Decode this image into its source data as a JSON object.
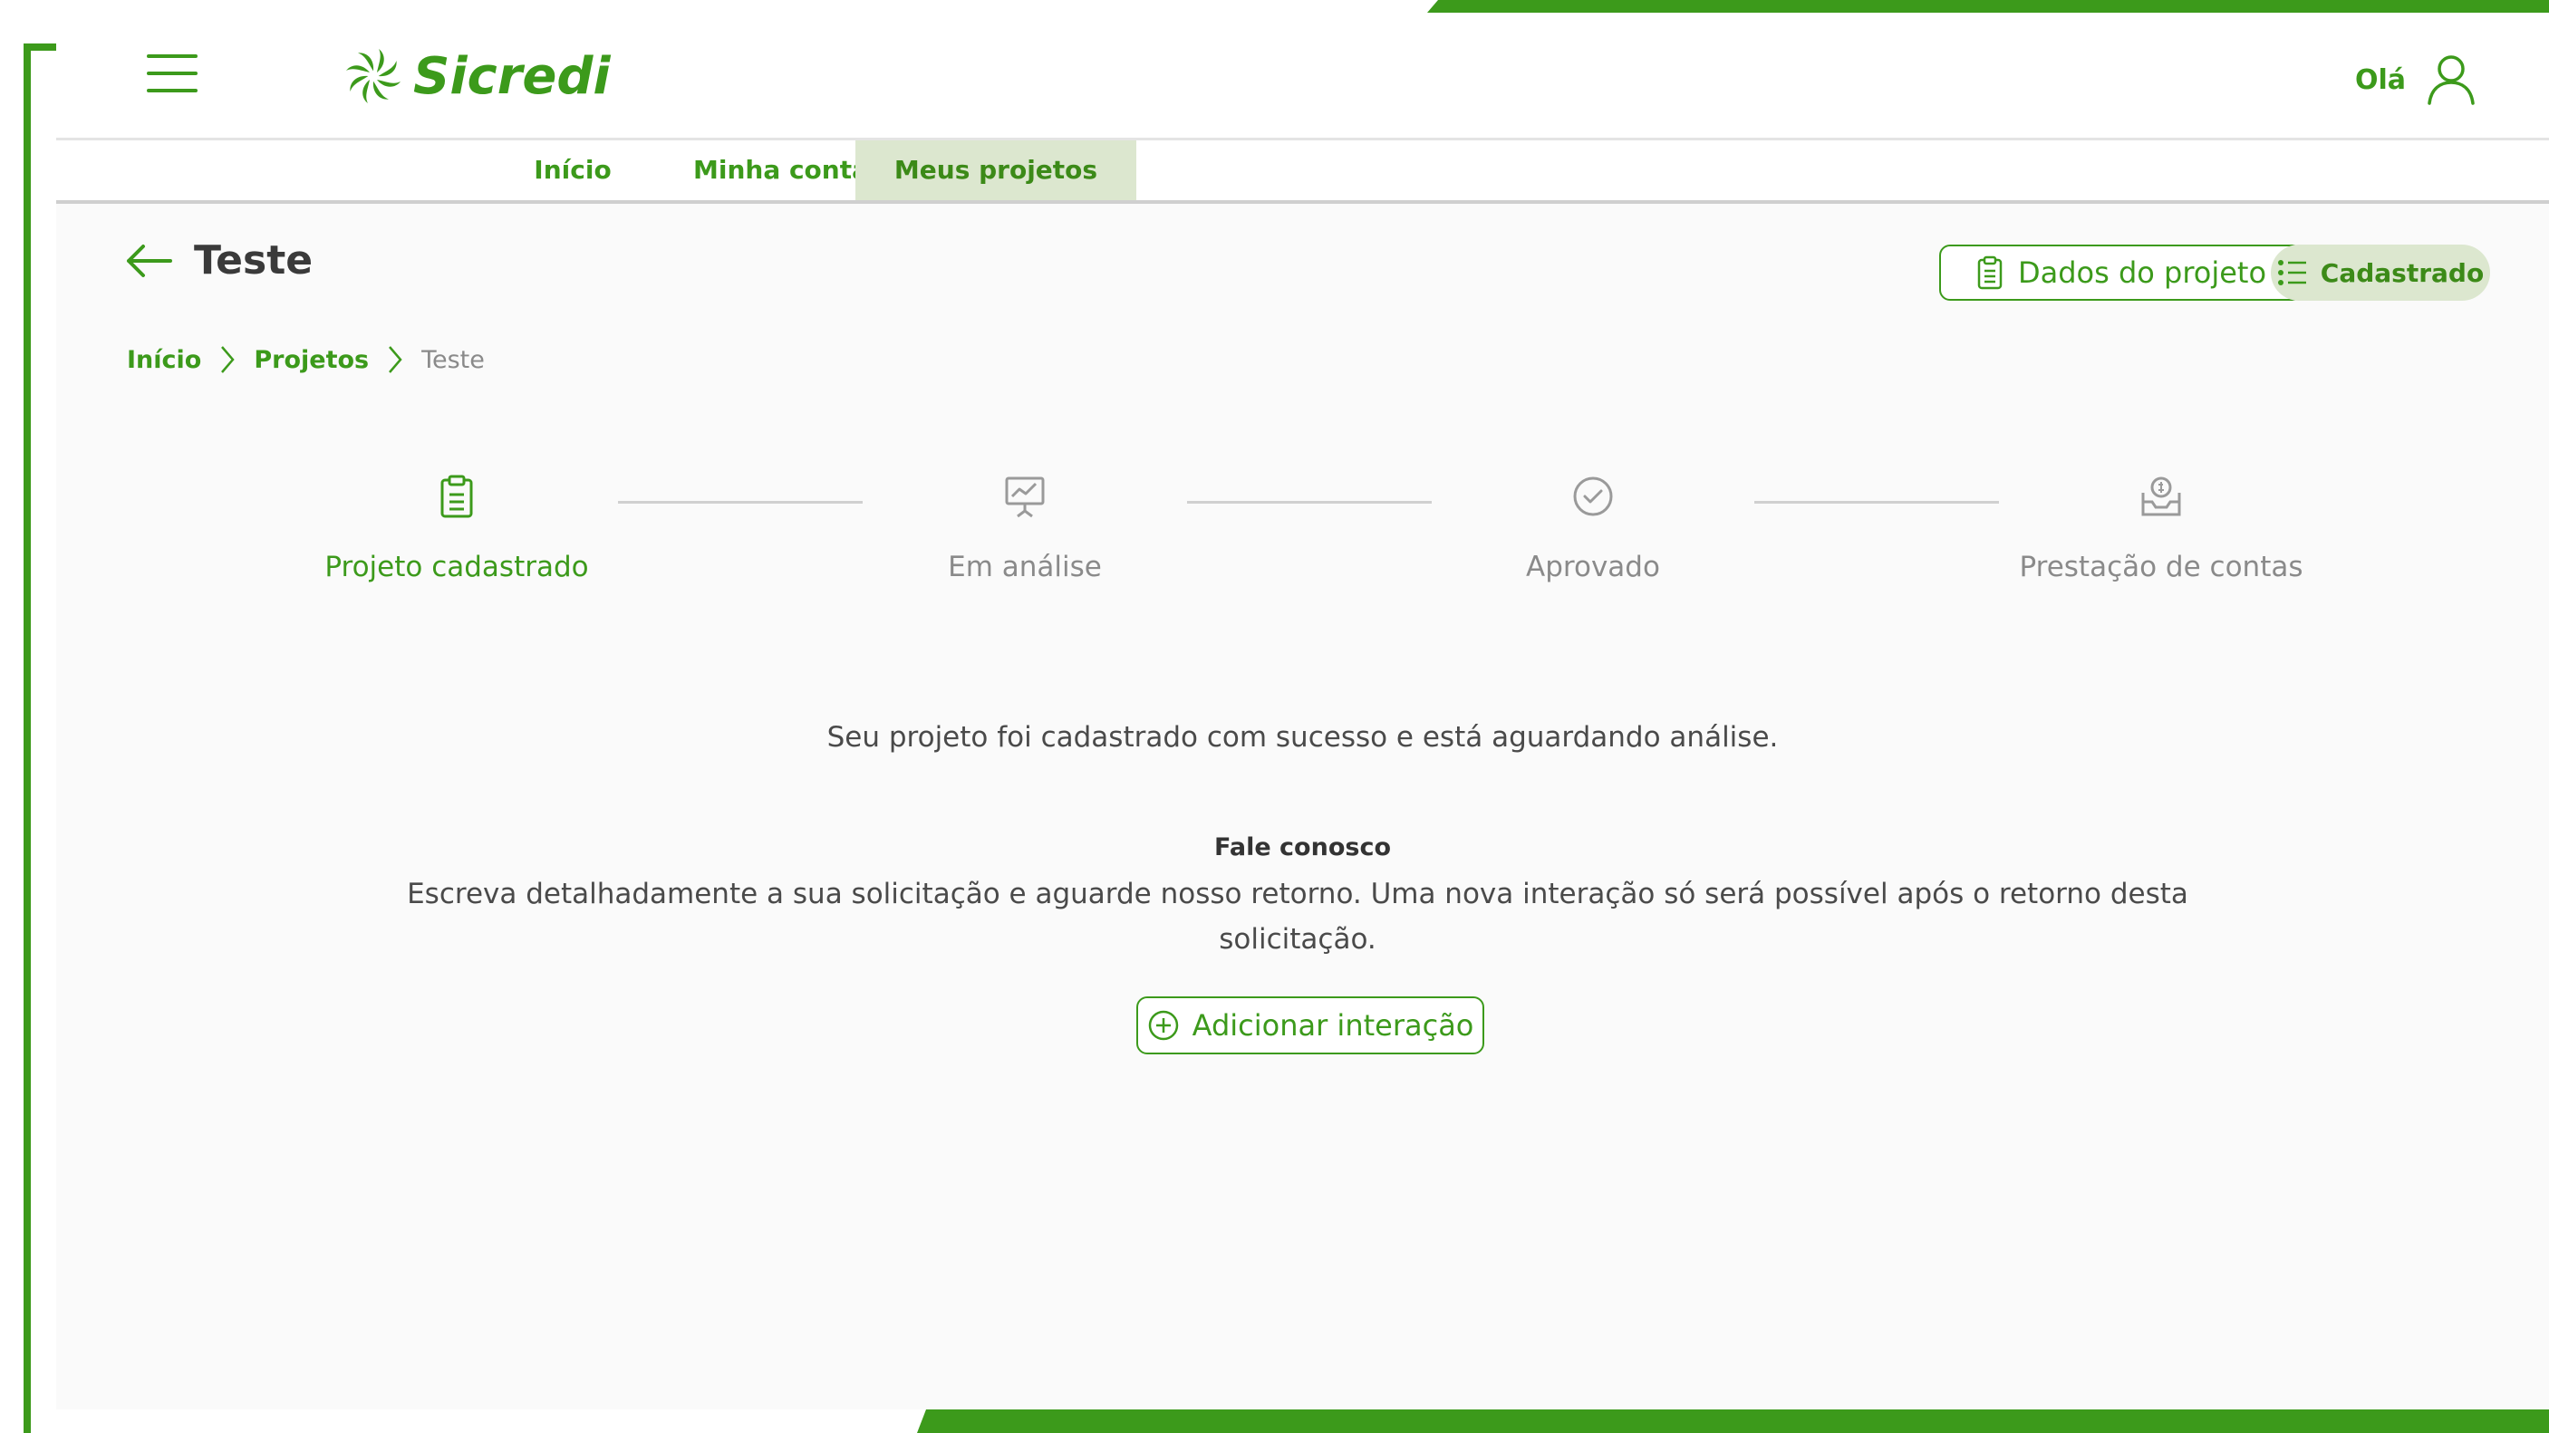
{
  "brand": {
    "name": "Sicredi",
    "accent": "#3c9a1b",
    "tint": "#dce7cf"
  },
  "header": {
    "greeting": "Olá",
    "menu_icon": "hamburger-menu-icon",
    "user_icon": "user-icon"
  },
  "tabs": [
    {
      "label": "Início",
      "active": false
    },
    {
      "label": "Minha conta",
      "active": false
    },
    {
      "label": "Meus projetos",
      "active": true
    }
  ],
  "page": {
    "title": "Teste",
    "breadcrumb": [
      "Início",
      "Projetos",
      "Teste"
    ],
    "project_data_button": "Dados do projeto",
    "status_badge": "Cadastrado"
  },
  "steps": [
    {
      "label": "Projeto cadastrado",
      "icon": "clipboard-icon",
      "done": true
    },
    {
      "label": "Em análise",
      "icon": "presentation-chart-icon",
      "done": false
    },
    {
      "label": "Aprovado",
      "icon": "check-circle-icon",
      "done": false
    },
    {
      "label": "Prestação de contas",
      "icon": "money-tray-icon",
      "done": false
    }
  ],
  "content": {
    "status_message": "Seu projeto foi cadastrado com sucesso e está aguardando análise.",
    "contact_heading": "Fale conosco",
    "contact_text": "Escreva detalhadamente a sua solicitação e aguarde nosso retorno. Uma nova interação só será possível após o retorno desta solicitação.",
    "add_button": "Adicionar interação"
  }
}
